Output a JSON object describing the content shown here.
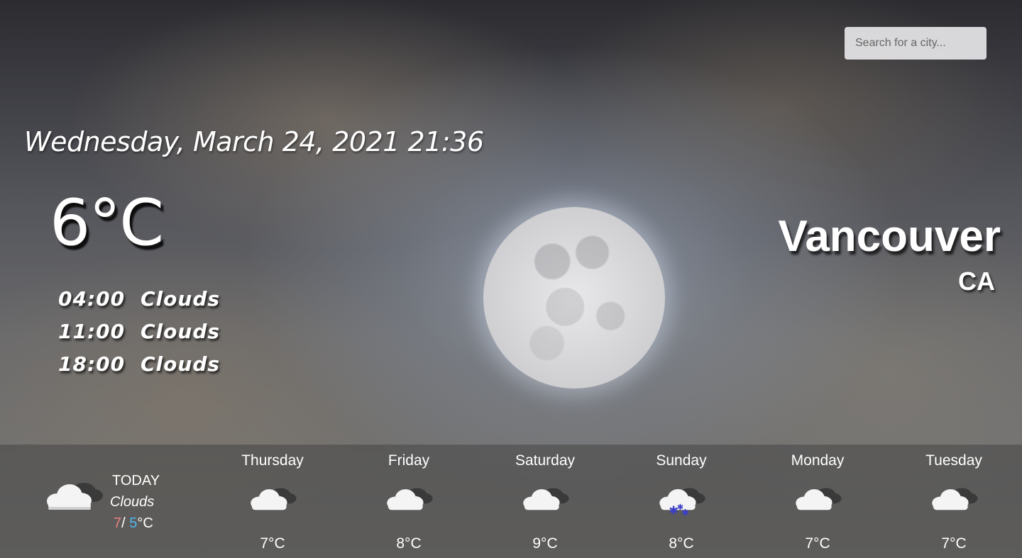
{
  "search": {
    "placeholder": "Search for a city..."
  },
  "current": {
    "datetime": "Wednesday, March 24, 2021 21:36",
    "temperature": "6°C",
    "city": "Vancouver",
    "country": "CA",
    "hourly": [
      {
        "time": "04:00",
        "condition": "Clouds"
      },
      {
        "time": "11:00",
        "condition": "Clouds"
      },
      {
        "time": "18:00",
        "condition": "Clouds"
      }
    ]
  },
  "today": {
    "label": "TODAY",
    "condition": "Clouds",
    "high": "7",
    "separator": "/ ",
    "low": "5",
    "unit": "°C",
    "icon": "cloud-icon"
  },
  "days": [
    {
      "name": "Thursday",
      "temp": "7°C",
      "icon": "cloud-icon"
    },
    {
      "name": "Friday",
      "temp": "8°C",
      "icon": "cloud-icon"
    },
    {
      "name": "Saturday",
      "temp": "9°C",
      "icon": "cloud-icon"
    },
    {
      "name": "Sunday",
      "temp": "8°C",
      "icon": "snow-cloud-icon"
    },
    {
      "name": "Monday",
      "temp": "7°C",
      "icon": "cloud-icon"
    },
    {
      "name": "Tuesday",
      "temp": "7°C",
      "icon": "cloud-icon"
    }
  ],
  "colors": {
    "high_temp": "#e88080",
    "low_temp": "#4fb6ee",
    "snowflake": "#3b3fc9"
  }
}
